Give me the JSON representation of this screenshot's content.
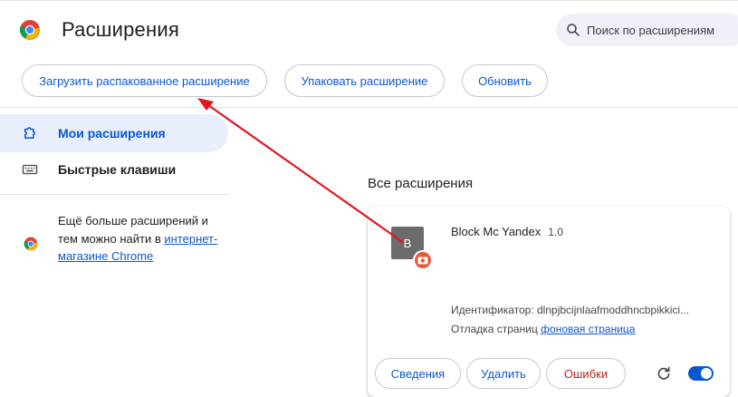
{
  "header": {
    "title": "Расширения",
    "search_placeholder": "Поиск по расширениям"
  },
  "toolbar": {
    "load_unpacked": "Загрузить распакованное расширение",
    "pack": "Упаковать расширение",
    "update": "Обновить"
  },
  "sidebar": {
    "items": [
      {
        "label": "Мои расширения",
        "icon": "puzzle-icon",
        "active": true
      },
      {
        "label": "Быстрые клавиши",
        "icon": "keyboard-icon",
        "active": false
      }
    ],
    "promo_text": "Ещё больше расширений и тем можно найти в",
    "promo_link": "интернет-магазине Chrome"
  },
  "main": {
    "section_title": "Все расширения",
    "extension": {
      "icon_letter": "B",
      "name": "Block Mc Yandex",
      "version": "1.0",
      "id_label": "Идентификатор: dlnpjbcijnlaafmoddhncbpikkici...",
      "debug_label": "Отладка страниц",
      "debug_link": "фоновая страница",
      "details_button": "Сведения",
      "remove_button": "Удалить",
      "errors_button": "Ошибки",
      "enabled": true
    }
  },
  "colors": {
    "accent": "#0b57d0",
    "danger": "#b3261e",
    "arrow": "#e0181e",
    "active_nav_bg": "#e8eefb"
  }
}
